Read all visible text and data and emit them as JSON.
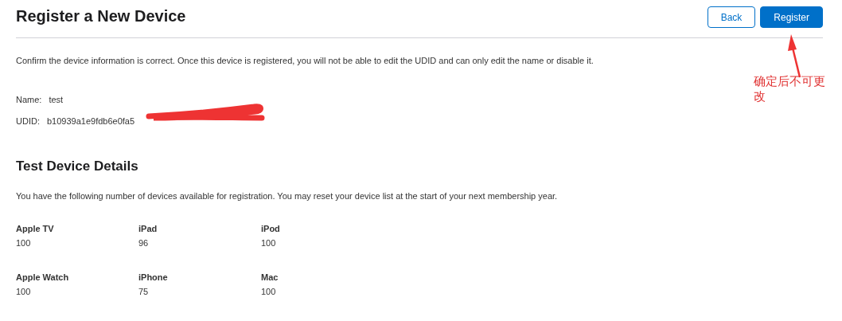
{
  "header": {
    "title": "Register a New Device",
    "buttons": [
      {
        "label": "Back",
        "kind": "secondary"
      },
      {
        "label": "Register",
        "kind": "primary"
      }
    ]
  },
  "intro": "Confirm the device information is correct. Once this device is registered, you will not be able to edit the UDID and can only edit the name or disable it.",
  "fields": [
    {
      "label": "Name:",
      "value": "test"
    },
    {
      "label": "UDID:",
      "value": "b10939a1e9fdb6e0fa5"
    }
  ],
  "details": {
    "title": "Test Device Details",
    "description": "You have the following number of devices available for registration. You may reset your device list at the start of your next membership year.",
    "devices": [
      {
        "name": "Apple TV",
        "count": "100"
      },
      {
        "name": "iPad",
        "count": "96"
      },
      {
        "name": "iPod",
        "count": "100"
      },
      {
        "name": "Apple Watch",
        "count": "100"
      },
      {
        "name": "iPhone",
        "count": "75"
      },
      {
        "name": "Mac",
        "count": "100"
      }
    ]
  },
  "annotation": {
    "text": "确定后不可更改"
  }
}
